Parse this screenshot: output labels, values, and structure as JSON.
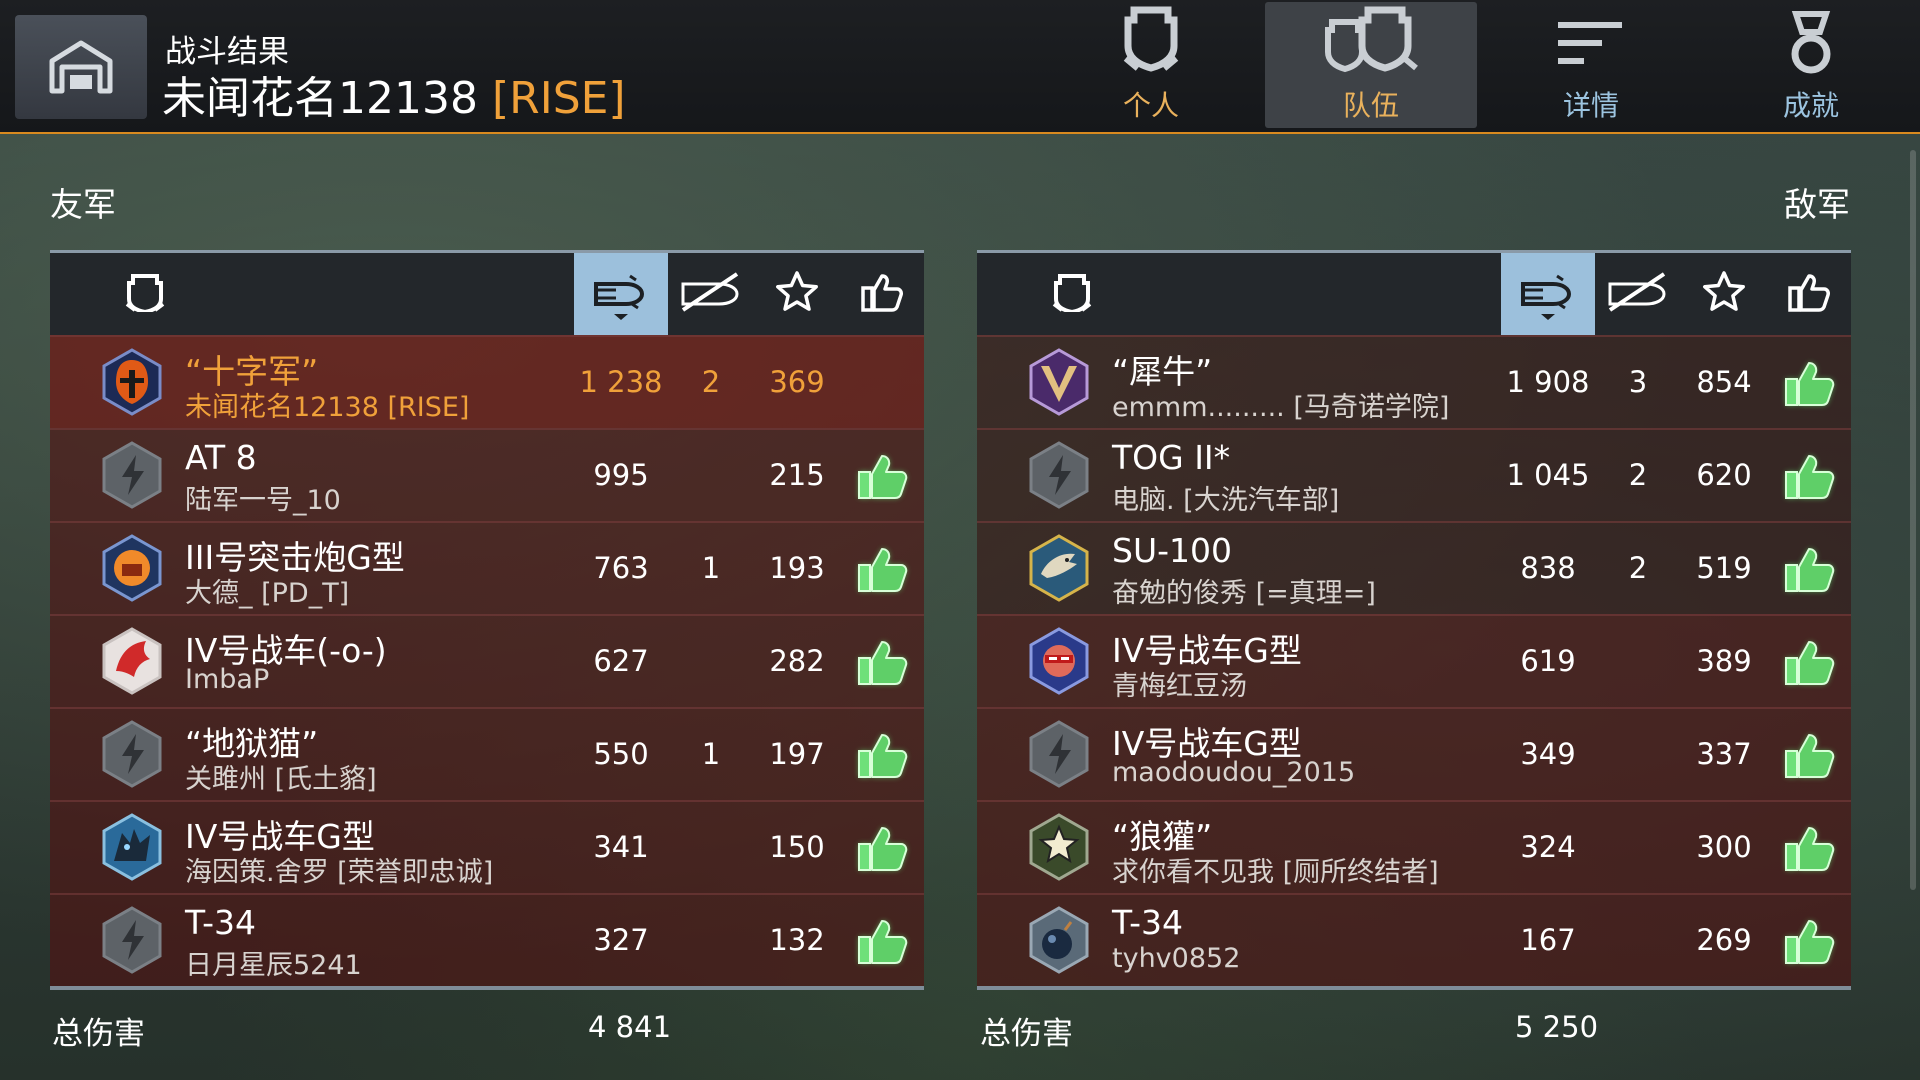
{
  "header": {
    "subtitle": "战斗结果",
    "player_name": "未闻花名12138",
    "player_clan": "[RISE]"
  },
  "tabs": [
    {
      "label": "个人",
      "icon": "single-tank-icon"
    },
    {
      "label": "队伍",
      "icon": "team-tanks-icon"
    },
    {
      "label": "详情",
      "icon": "details-list-icon"
    },
    {
      "label": "成就",
      "icon": "medal-icon"
    }
  ],
  "allies": {
    "title": "友军",
    "total_label": "总伤害",
    "total_damage": "4 841",
    "rows": [
      {
        "tank": "“十字军”",
        "player": "未闻花名12138 [RISE]",
        "damage": "1 238",
        "kills": "2",
        "exp": "369",
        "liked": false,
        "self": true,
        "avatar": "crusader-helmet-avatar"
      },
      {
        "tank": "AT 8",
        "player": "陆军一号_10",
        "damage": "995",
        "kills": "",
        "exp": "215",
        "liked": true,
        "avatar": "default-avatar"
      },
      {
        "tank": "III号突击炮G型",
        "player": "大德_ [PD_T]",
        "damage": "763",
        "kills": "1",
        "exp": "193",
        "liked": true,
        "avatar": "fist-avatar"
      },
      {
        "tank": "IV号战车(-o-)",
        "player": "ImbaP",
        "damage": "627",
        "kills": "",
        "exp": "282",
        "liked": true,
        "avatar": "red-bird-avatar"
      },
      {
        "tank": "“地狱猫”",
        "player": "关雎州 [氏土貉]",
        "damage": "550",
        "kills": "1",
        "exp": "197",
        "liked": true,
        "avatar": "default-avatar"
      },
      {
        "tank": "IV号战车G型",
        "player": "海因策.舍罗 [荣誉即忠诚]",
        "damage": "341",
        "kills": "",
        "exp": "150",
        "liked": true,
        "avatar": "blue-wolf-avatar"
      },
      {
        "tank": "T-34",
        "player": "日月星辰5241",
        "damage": "327",
        "kills": "",
        "exp": "132",
        "liked": true,
        "avatar": "default-avatar"
      }
    ]
  },
  "enemies": {
    "title": "敌军",
    "total_label": "总伤害",
    "total_damage": "5 250",
    "rows": [
      {
        "tank": "“犀牛”",
        "player": "emmm......... [马奇诺学院]",
        "damage": "1 908",
        "kills": "3",
        "exp": "854",
        "liked": true,
        "avatar": "purple-v-avatar"
      },
      {
        "tank": "TOG II*",
        "player": "电脑. [大洗汽车部]",
        "damage": "1 045",
        "kills": "2",
        "exp": "620",
        "liked": true,
        "avatar": "default-avatar"
      },
      {
        "tank": "SU-100",
        "player": "奋勉的俊秀 [=真理=]",
        "damage": "838",
        "kills": "2",
        "exp": "519",
        "liked": true,
        "avatar": "eagle-avatar"
      },
      {
        "tank": "IV号战车G型",
        "player": "青梅红豆汤",
        "damage": "619",
        "kills": "",
        "exp": "389",
        "liked": true,
        "avatar": "hero-avatar"
      },
      {
        "tank": "IV号战车G型",
        "player": "maodoudou_2015",
        "damage": "349",
        "kills": "",
        "exp": "337",
        "liked": true,
        "avatar": "default-avatar"
      },
      {
        "tank": "“狼獾”",
        "player": "求你看不见我 [厕所终结者]",
        "damage": "324",
        "kills": "",
        "exp": "300",
        "liked": true,
        "avatar": "star-avatar"
      },
      {
        "tank": "T-34",
        "player": "tyhv0852",
        "damage": "167",
        "kills": "",
        "exp": "269",
        "liked": true,
        "avatar": "bomb-avatar"
      }
    ]
  },
  "columns": [
    {
      "icon": "tank-icon"
    },
    {
      "icon": "damage-shell-icon",
      "selected": true
    },
    {
      "icon": "kills-icon"
    },
    {
      "icon": "star-icon"
    },
    {
      "icon": "thumbs-up-icon"
    }
  ],
  "colors": {
    "accent": "#d98a1f",
    "self_text": "#f0a13a",
    "selected_column": "#9cc0dc",
    "like_green": "#5fd06a"
  }
}
